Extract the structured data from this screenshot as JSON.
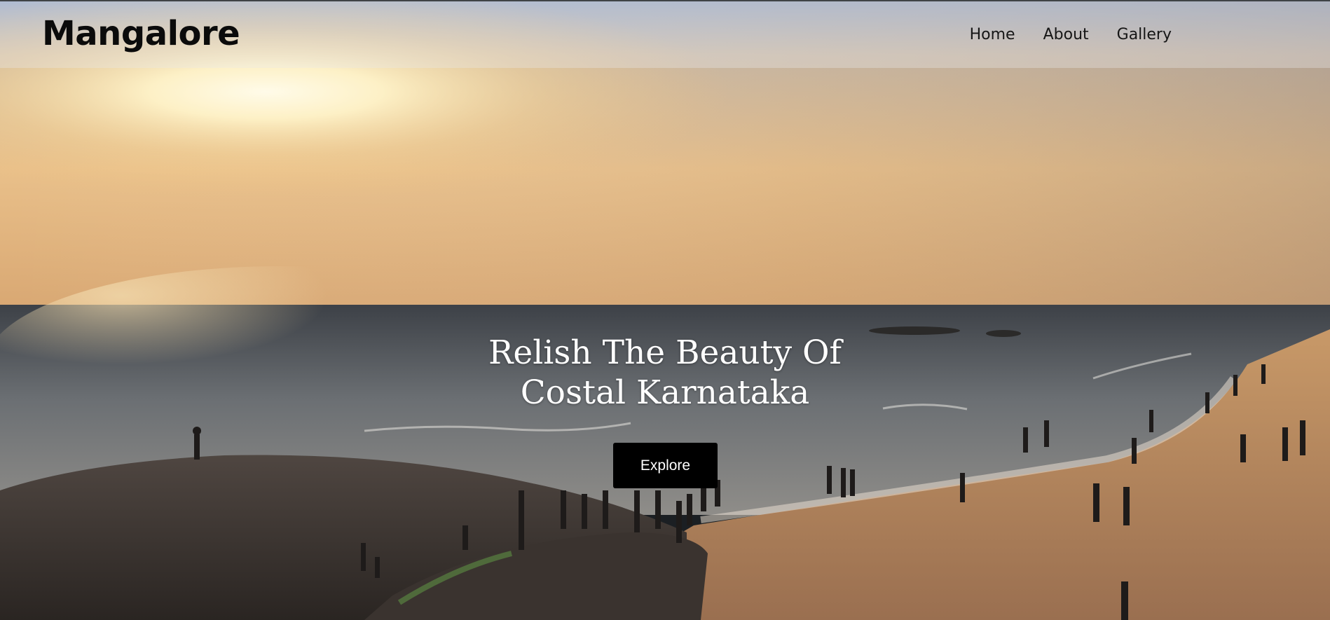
{
  "header": {
    "logo": "Mangalore",
    "nav": [
      {
        "label": "Home"
      },
      {
        "label": "About"
      },
      {
        "label": "Gallery"
      }
    ]
  },
  "hero": {
    "image": "sunset-beach-photo",
    "headline_line1": "Relish The Beauty Of",
    "headline_line2": "Costal Karnataka",
    "cta_label": "Explore"
  },
  "colors": {
    "header_overlay": "#e8e8ec",
    "logo_text": "#0b0b0b",
    "button_bg": "#000000",
    "button_text": "#ffffff",
    "headline_text": "#ffffff"
  }
}
